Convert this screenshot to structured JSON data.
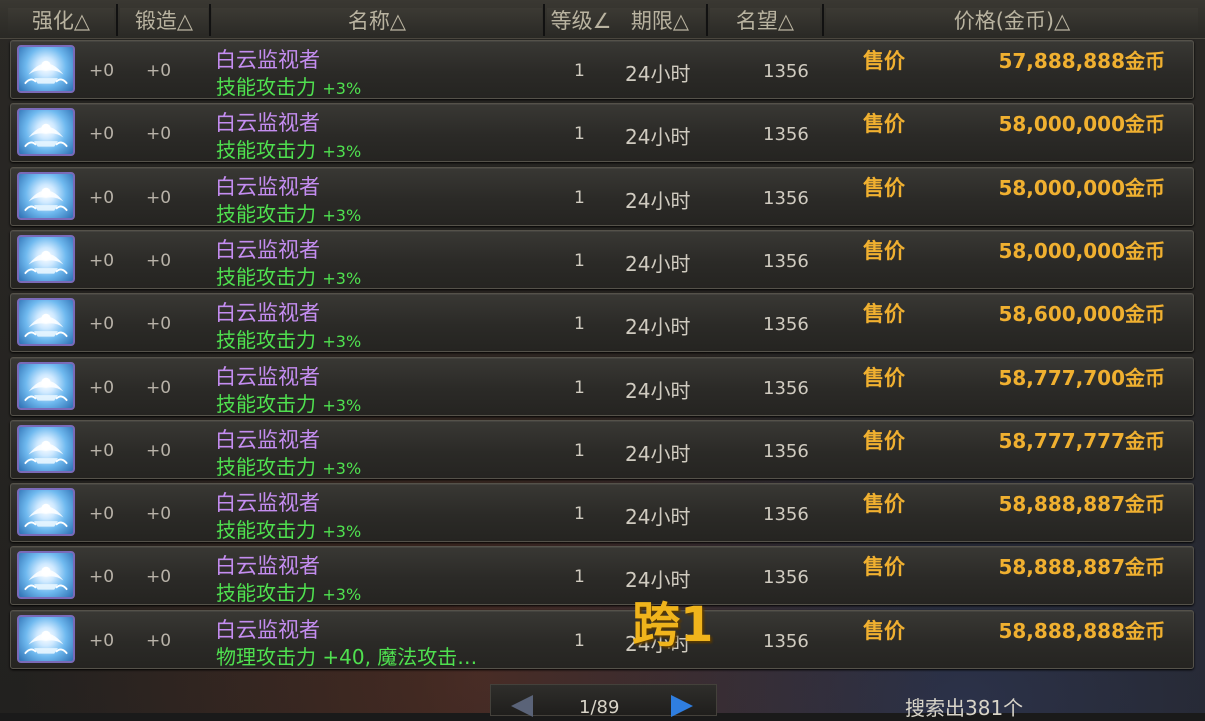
{
  "headers": [
    "强化△",
    "锻造△",
    "名称△",
    "等级∠",
    "期限△",
    "名望△",
    "价格(金币)△"
  ],
  "sell_label": "售价",
  "rows": [
    {
      "enhance": "+0",
      "forge": "+0",
      "name": "白云监视者",
      "stat": "技能攻击力",
      "stat_val": "+3%",
      "level": "1",
      "duration": "24小时",
      "fame": "1356",
      "price": "57,888,888金币"
    },
    {
      "enhance": "+0",
      "forge": "+0",
      "name": "白云监视者",
      "stat": "技能攻击力",
      "stat_val": "+3%",
      "level": "1",
      "duration": "24小时",
      "fame": "1356",
      "price": "58,000,000金币"
    },
    {
      "enhance": "+0",
      "forge": "+0",
      "name": "白云监视者",
      "stat": "技能攻击力",
      "stat_val": "+3%",
      "level": "1",
      "duration": "24小时",
      "fame": "1356",
      "price": "58,000,000金币"
    },
    {
      "enhance": "+0",
      "forge": "+0",
      "name": "白云监视者",
      "stat": "技能攻击力",
      "stat_val": "+3%",
      "level": "1",
      "duration": "24小时",
      "fame": "1356",
      "price": "58,000,000金币"
    },
    {
      "enhance": "+0",
      "forge": "+0",
      "name": "白云监视者",
      "stat": "技能攻击力",
      "stat_val": "+3%",
      "level": "1",
      "duration": "24小时",
      "fame": "1356",
      "price": "58,600,000金币"
    },
    {
      "enhance": "+0",
      "forge": "+0",
      "name": "白云监视者",
      "stat": "技能攻击力",
      "stat_val": "+3%",
      "level": "1",
      "duration": "24小时",
      "fame": "1356",
      "price": "58,777,700金币"
    },
    {
      "enhance": "+0",
      "forge": "+0",
      "name": "白云监视者",
      "stat": "技能攻击力",
      "stat_val": "+3%",
      "level": "1",
      "duration": "24小时",
      "fame": "1356",
      "price": "58,777,777金币"
    },
    {
      "enhance": "+0",
      "forge": "+0",
      "name": "白云监视者",
      "stat": "技能攻击力",
      "stat_val": "+3%",
      "level": "1",
      "duration": "24小时",
      "fame": "1356",
      "price": "58,888,887金币"
    },
    {
      "enhance": "+0",
      "forge": "+0",
      "name": "白云监视者",
      "stat": "技能攻击力",
      "stat_val": "+3%",
      "level": "1",
      "duration": "24小时",
      "fame": "1356",
      "price": "58,888,887金币"
    },
    {
      "enhance": "+0",
      "forge": "+0",
      "name": "白云监视者",
      "stat": "物理攻击力 +40, 魔法攻击…",
      "stat_val": "",
      "level": "1",
      "duration": "24小时",
      "fame": "1356",
      "price": "58,888,888金币"
    }
  ],
  "pagination": {
    "text": "1/89"
  },
  "result_count": "搜索出381个",
  "watermark": "跨1",
  "colors": {
    "name": "#c48df0",
    "stat": "#4fe04f",
    "price": "#f0b030",
    "next_arrow": "#2f7ee0"
  }
}
